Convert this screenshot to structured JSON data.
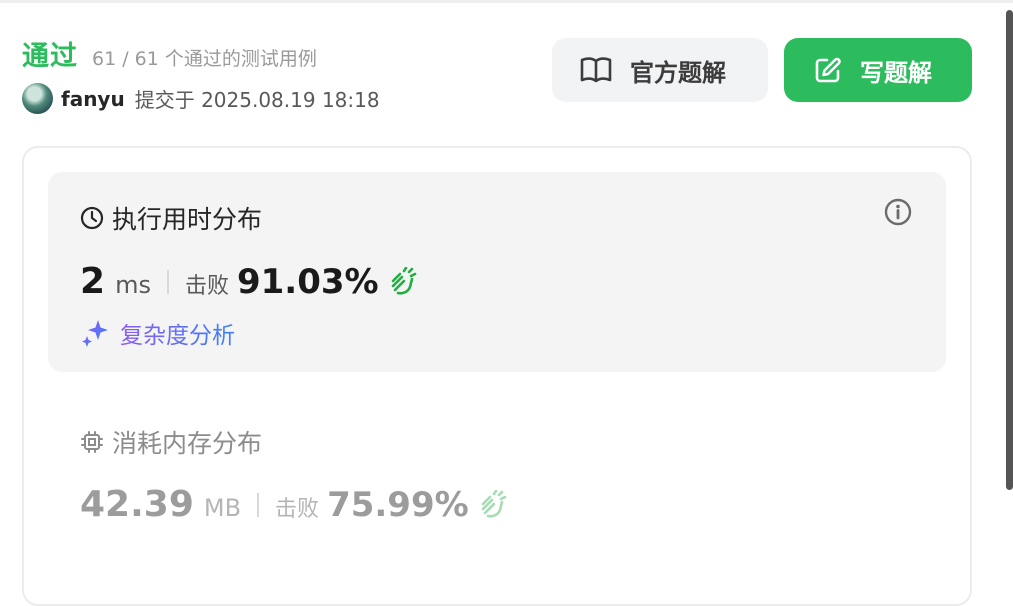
{
  "submission": {
    "status": "通过",
    "cases_passed_text": "61 / 61 个通过的测试用例",
    "username": "fanyu",
    "submitted_text": "提交于 2025.08.19 18:18"
  },
  "buttons": {
    "official_solution": "官方题解",
    "write_solution": "写题解"
  },
  "runtime": {
    "title": "执行用时分布",
    "value": "2",
    "unit": "ms",
    "beats_label": "击败",
    "beats_value": "91.03%",
    "complexity_label": "复杂度分析"
  },
  "memory": {
    "title": "消耗内存分布",
    "value": "42.39",
    "unit": "MB",
    "beats_label": "击败",
    "beats_value": "75.99%"
  },
  "colors": {
    "accent_green": "#2cbb5d",
    "clap_green": "#1fae3f",
    "clap_green_muted": "#a6dcb2",
    "complexity_gradient_start": "#8a5cf6",
    "complexity_gradient_end": "#3b82f6"
  },
  "icons": {
    "official_solution": "book-open-icon",
    "write_solution": "edit-icon",
    "runtime": "clock-icon",
    "memory": "cpu-chip-icon",
    "info": "info-icon",
    "beats": "clapping-hands-icon",
    "complexity": "sparkle-icon"
  }
}
